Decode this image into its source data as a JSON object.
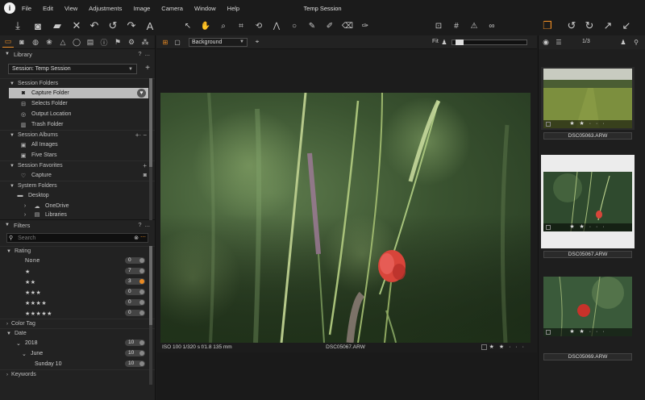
{
  "window": {
    "title": "Temp Session"
  },
  "menu": [
    {
      "label": "File",
      "key": "F"
    },
    {
      "label": "Edit",
      "key": "E"
    },
    {
      "label": "View",
      "key": "V"
    },
    {
      "label": "Adjustments",
      "key": "A"
    },
    {
      "label": "Image",
      "key": "I"
    },
    {
      "label": "Camera",
      "key": "C"
    },
    {
      "label": "Window",
      "key": "W"
    },
    {
      "label": "Help",
      "key": "H"
    }
  ],
  "toolbar_icons": [
    "import-icon",
    "capture-icon",
    "open-folder-icon",
    "delete-icon",
    "undo-icon",
    "rotate-back-icon",
    "redo-icon",
    "text-icon",
    "cursor-icon",
    "pan-hand-icon",
    "loupe-icon",
    "crop-icon",
    "rotate-tool-icon",
    "keystone-icon",
    "circle-mask-icon",
    "brush-icon",
    "picker-icon",
    "eraser-icon",
    "gradient-icon",
    "grid-icon",
    "warning-icon",
    "glasses-icon",
    "stack-icon",
    "rotate-left-icon",
    "rotate-right-icon",
    "expand-icon",
    "collapse-icon"
  ],
  "library": {
    "title": "Library",
    "help": "?",
    "more": "...",
    "session_select": "Session: Temp Session",
    "session_folders": {
      "label": "Session Folders",
      "items": [
        "Capture Folder",
        "Selects Folder",
        "Output Location",
        "Trash Folder"
      ]
    },
    "session_albums": {
      "label": "Session Albums",
      "items": [
        "All Images",
        "Five Stars"
      ]
    },
    "session_favorites": {
      "label": "Session Favorites",
      "items": [
        "Capture"
      ]
    },
    "system_folders": {
      "label": "System Folders",
      "items": [
        "Desktop",
        "OneDrive",
        "Libraries"
      ]
    }
  },
  "filters": {
    "title": "Filters",
    "help": "?",
    "more": "...",
    "search_placeholder": "Search",
    "rating": {
      "label": "Rating",
      "rows": [
        {
          "label": "None",
          "count": "0"
        },
        {
          "label": "★",
          "count": "7"
        },
        {
          "label": "★★",
          "count": "3",
          "active": true
        },
        {
          "label": "★★★",
          "count": "0"
        },
        {
          "label": "★★★★",
          "count": "0"
        },
        {
          "label": "★★★★★",
          "count": "0"
        }
      ]
    },
    "color_tag": {
      "label": "Color Tag"
    },
    "date": {
      "label": "Date",
      "rows": [
        {
          "label": "2018",
          "count": "10"
        },
        {
          "label": "June",
          "count": "10"
        },
        {
          "label": "Sunday 10",
          "count": "10"
        }
      ]
    },
    "keywords": {
      "label": "Keywords"
    }
  },
  "viewer": {
    "background_select": "Background",
    "fit_label": "Fit",
    "exif": "ISO 100  1/320 s  f/1.8  135 mm",
    "filename": "DSC05067.ARW",
    "rating": "★ ★ · · ·"
  },
  "browser": {
    "counter": "1/3",
    "thumbnails": [
      {
        "filename": "DSC05063.ARW",
        "rating": "★ ★ · · ·",
        "selected": false
      },
      {
        "filename": "DSC05067.ARW",
        "rating": "★ ★ · · ·",
        "selected": true
      },
      {
        "filename": "DSC05069.ARW",
        "rating": "★ ★ · · ·",
        "selected": false
      }
    ]
  },
  "colors": {
    "accent": "#e98a23",
    "panel": "#222222",
    "background": "#1c1c1c",
    "selection": "#bdbdbd"
  }
}
